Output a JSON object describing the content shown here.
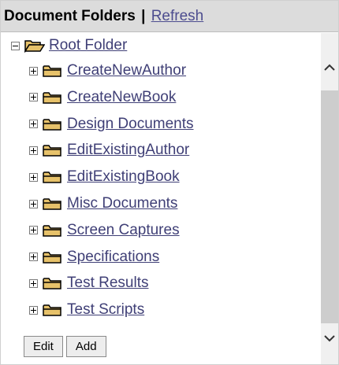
{
  "header": {
    "title": "Document Folders",
    "separator": "|",
    "refresh_label": "Refresh"
  },
  "tree": {
    "root": {
      "label": "Root Folder",
      "expanded": true,
      "icon": "open-folder-icon"
    },
    "children": [
      {
        "label": "CreateNewAuthor",
        "expanded": false,
        "icon": "folder-icon"
      },
      {
        "label": "CreateNewBook",
        "expanded": false,
        "icon": "folder-icon"
      },
      {
        "label": "Design Documents",
        "expanded": false,
        "icon": "folder-icon"
      },
      {
        "label": "EditExistingAuthor",
        "expanded": false,
        "icon": "folder-icon"
      },
      {
        "label": "EditExistingBook",
        "expanded": false,
        "icon": "folder-icon"
      },
      {
        "label": "Misc Documents",
        "expanded": false,
        "icon": "folder-icon"
      },
      {
        "label": "Screen Captures",
        "expanded": false,
        "icon": "folder-icon"
      },
      {
        "label": "Specifications",
        "expanded": false,
        "icon": "folder-icon"
      },
      {
        "label": "Test Results",
        "expanded": false,
        "icon": "folder-icon"
      },
      {
        "label": "Test Scripts",
        "expanded": false,
        "icon": "folder-icon"
      }
    ]
  },
  "buttons": {
    "edit_label": "Edit",
    "add_label": "Add"
  },
  "colors": {
    "header_bg": "#dcdcdc",
    "link": "#3f3f76",
    "folder_fill": "#e7c26a",
    "folder_outline": "#000000",
    "scrollbar_thumb": "#cdcdcd"
  }
}
